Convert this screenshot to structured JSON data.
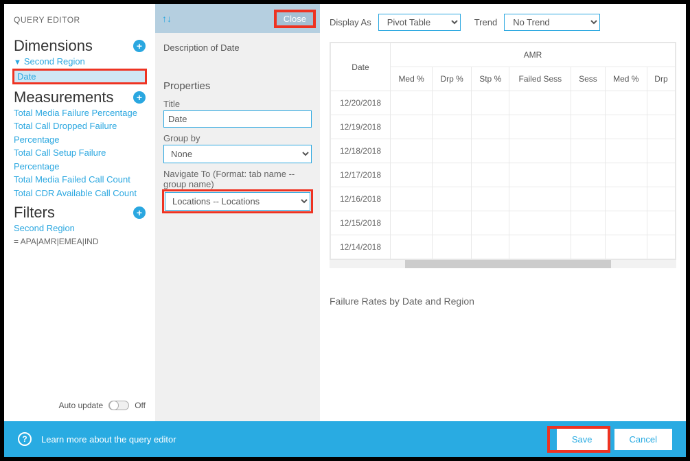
{
  "sidebar": {
    "editor_title": "QUERY EDITOR",
    "dimensions": {
      "heading": "Dimensions",
      "items": [
        "Second Region",
        "Date"
      ]
    },
    "measurements": {
      "heading": "Measurements",
      "items": [
        "Total Media Failure Percentage",
        "Total Call Dropped Failure Percentage",
        "Total Call Setup Failure Percentage",
        "Total Media Failed Call Count",
        "Total CDR Available Call Count"
      ]
    },
    "filters": {
      "heading": "Filters",
      "items": [
        "Second Region"
      ],
      "expr": "= APA|AMR|EMEA|IND"
    },
    "auto_update": {
      "label": "Auto update",
      "state": "Off"
    }
  },
  "middle": {
    "close_label": "Close",
    "description": "Description of Date",
    "properties_heading": "Properties",
    "title_label": "Title",
    "title_value": "Date",
    "group_by_label": "Group by",
    "group_by_value": "None",
    "navigate_label": "Navigate To (Format: tab name -- group name)",
    "navigate_value": "Locations -- Locations"
  },
  "right": {
    "display_as_label": "Display As",
    "display_as_value": "Pivot Table",
    "trend_label": "Trend",
    "trend_value": "No Trend",
    "pivot": {
      "row_header": "Date",
      "group_header": "AMR",
      "columns": [
        "Med %",
        "Drp %",
        "Stp %",
        "Failed Sess",
        "Sess",
        "Med %",
        "Drp"
      ],
      "rows": [
        "12/20/2018",
        "12/19/2018",
        "12/18/2018",
        "12/17/2018",
        "12/16/2018",
        "12/15/2018",
        "12/14/2018"
      ]
    },
    "caption": "Failure Rates by Date and Region"
  },
  "footer": {
    "help_text": "Learn more about the query editor",
    "save": "Save",
    "cancel": "Cancel"
  }
}
